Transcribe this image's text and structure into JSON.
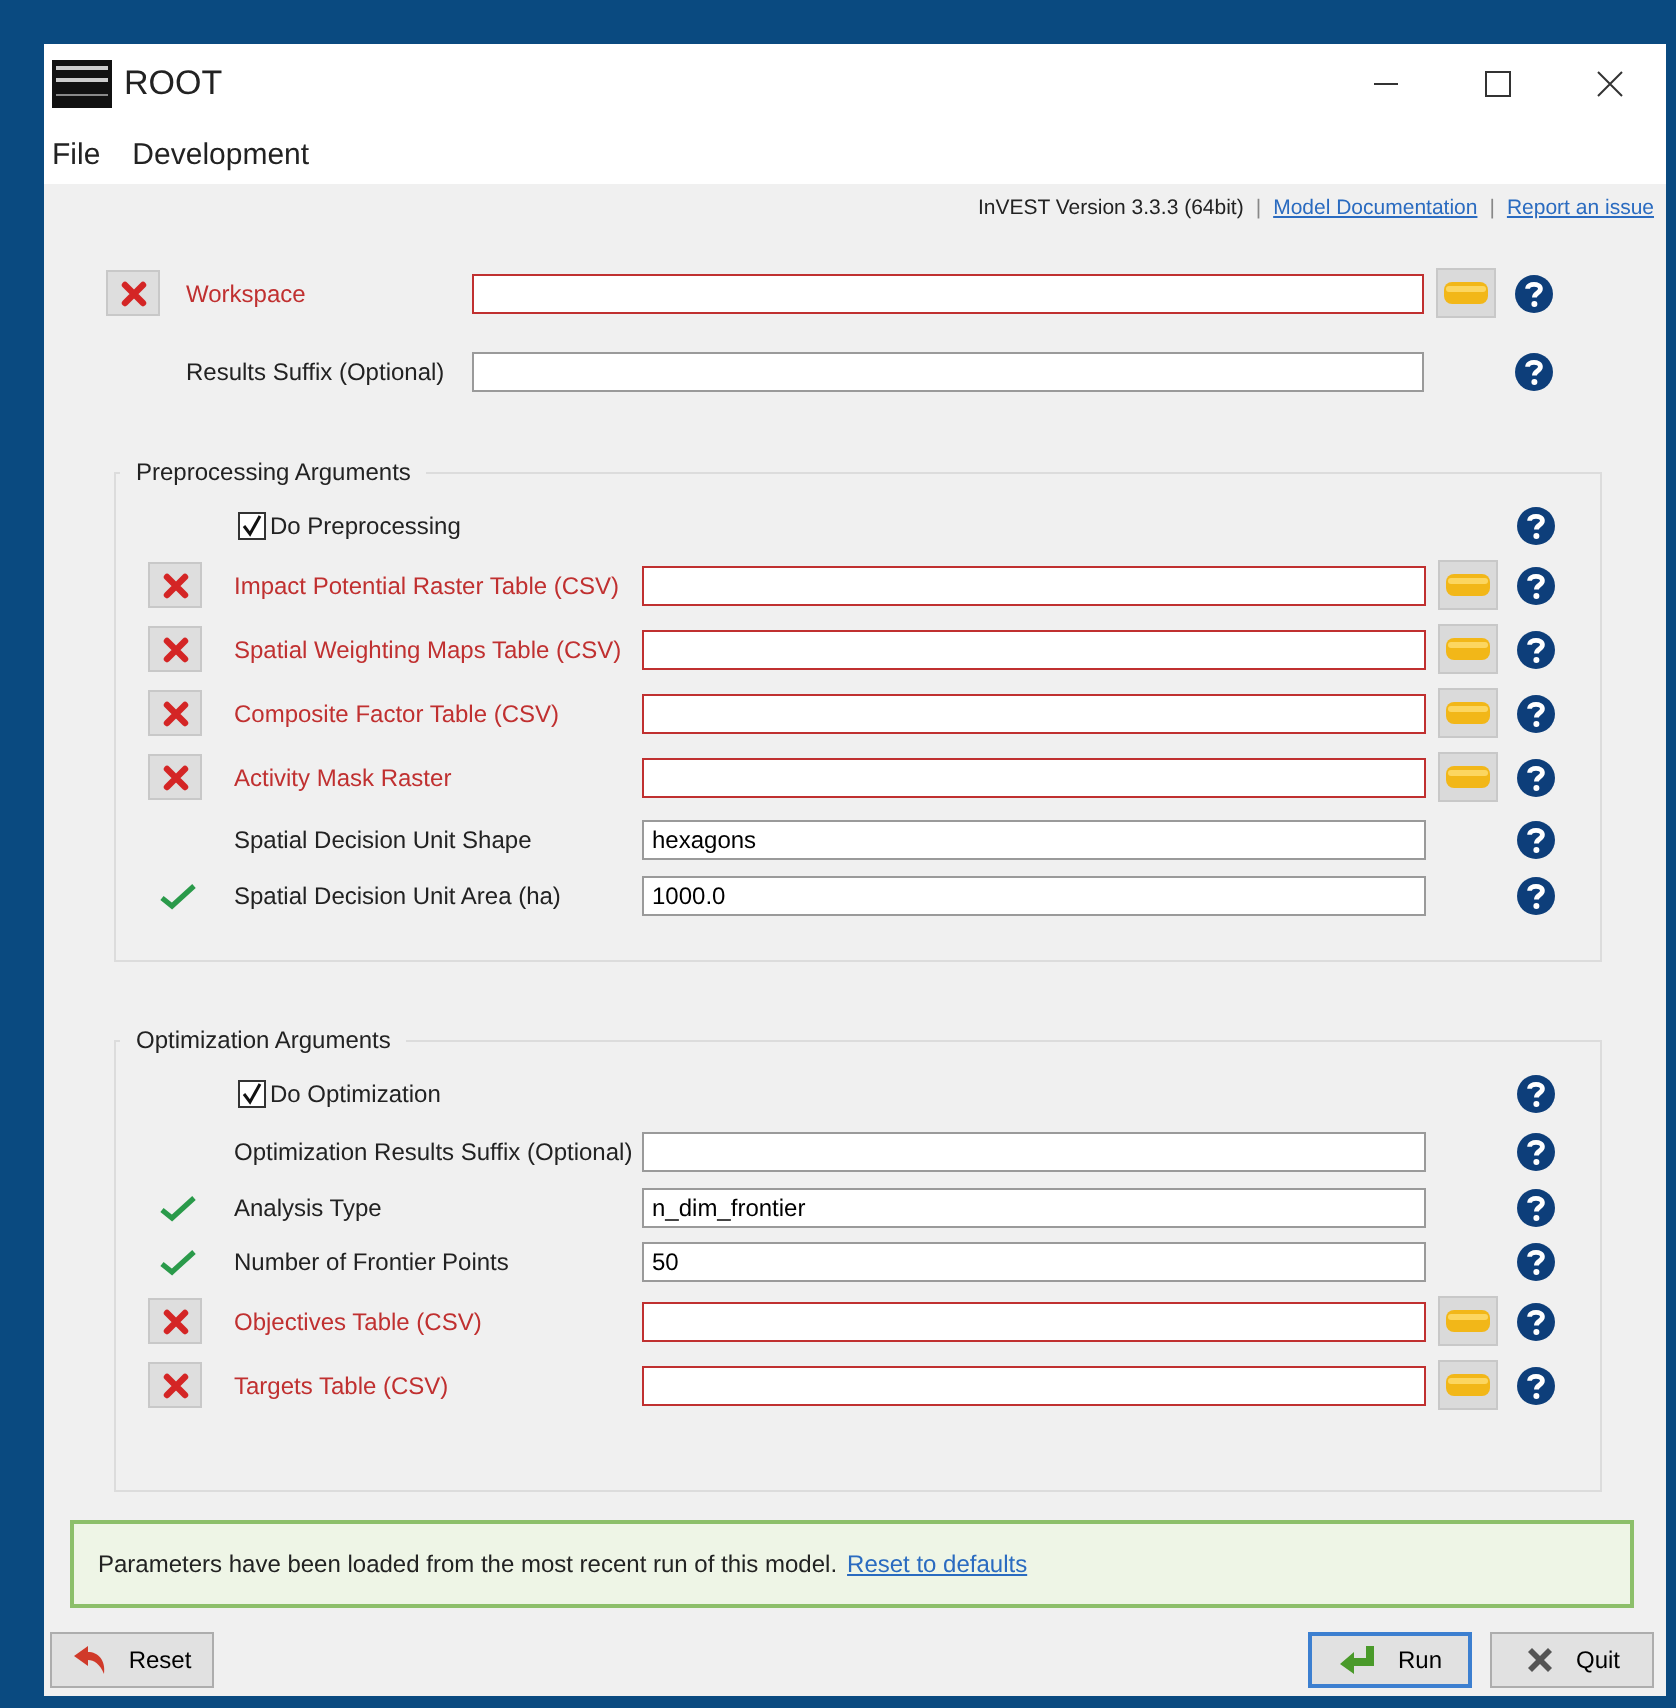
{
  "window": {
    "title": "ROOT"
  },
  "menu": [
    {
      "label": "File"
    },
    {
      "label": "Development"
    }
  ],
  "header": [
    {
      "kind": "text",
      "text": "InVEST Version 3.3.3 (64bit)"
    },
    {
      "kind": "separator",
      "text": "|"
    },
    {
      "kind": "link",
      "text": "Model Documentation"
    },
    {
      "kind": "separator",
      "text": "|"
    },
    {
      "kind": "link",
      "text": "Report an issue"
    }
  ],
  "top_fields": [
    {
      "kind": "file",
      "invalid": true,
      "valid": false,
      "label": "Workspace"
    },
    {
      "kind": "text",
      "invalid": false,
      "valid": false,
      "label": "Results Suffix (Optional)"
    }
  ],
  "groups": [
    {
      "title": "Preprocessing Arguments",
      "rows": [
        {
          "kind": "checkbox",
          "label": "Do Preprocessing",
          "checked": true
        },
        {
          "kind": "file",
          "invalid": true,
          "valid": false,
          "label": "Impact Potential Raster Table (CSV)"
        },
        {
          "kind": "file",
          "invalid": true,
          "valid": false,
          "label": "Spatial Weighting Maps Table (CSV)"
        },
        {
          "kind": "file",
          "invalid": true,
          "valid": false,
          "label": "Composite Factor Table (CSV)"
        },
        {
          "kind": "file",
          "invalid": true,
          "valid": false,
          "label": "Activity Mask Raster"
        },
        {
          "kind": "text",
          "invalid": false,
          "valid": false,
          "label": "Spatial Decision Unit Shape",
          "value": "hexagons"
        },
        {
          "kind": "text",
          "invalid": false,
          "valid": true,
          "label": "Spatial Decision Unit Area (ha)",
          "value": "1000.0"
        }
      ]
    },
    {
      "title": "Optimization Arguments",
      "rows": [
        {
          "kind": "checkbox",
          "label": "Do Optimization",
          "checked": true
        },
        {
          "kind": "text",
          "invalid": false,
          "valid": false,
          "label": "Optimization Results Suffix (Optional)"
        },
        {
          "kind": "text",
          "invalid": false,
          "valid": true,
          "label": "Analysis Type",
          "value": "n_dim_frontier"
        },
        {
          "kind": "text",
          "invalid": false,
          "valid": true,
          "label": "Number of Frontier Points",
          "value": "50"
        },
        {
          "kind": "file",
          "invalid": true,
          "valid": false,
          "label": "Objectives Table (CSV)"
        },
        {
          "kind": "file",
          "invalid": true,
          "valid": false,
          "label": "Targets Table (CSV)"
        }
      ]
    }
  ],
  "message": {
    "text": "Parameters have been loaded from the most recent run of this model.",
    "link": "Reset to defaults"
  },
  "buttons": [
    {
      "kind": "reset",
      "label": "Reset",
      "default": false
    },
    {
      "kind": "run",
      "label": "Run",
      "default": true
    },
    {
      "kind": "quit",
      "label": "Quit",
      "default": false
    }
  ]
}
